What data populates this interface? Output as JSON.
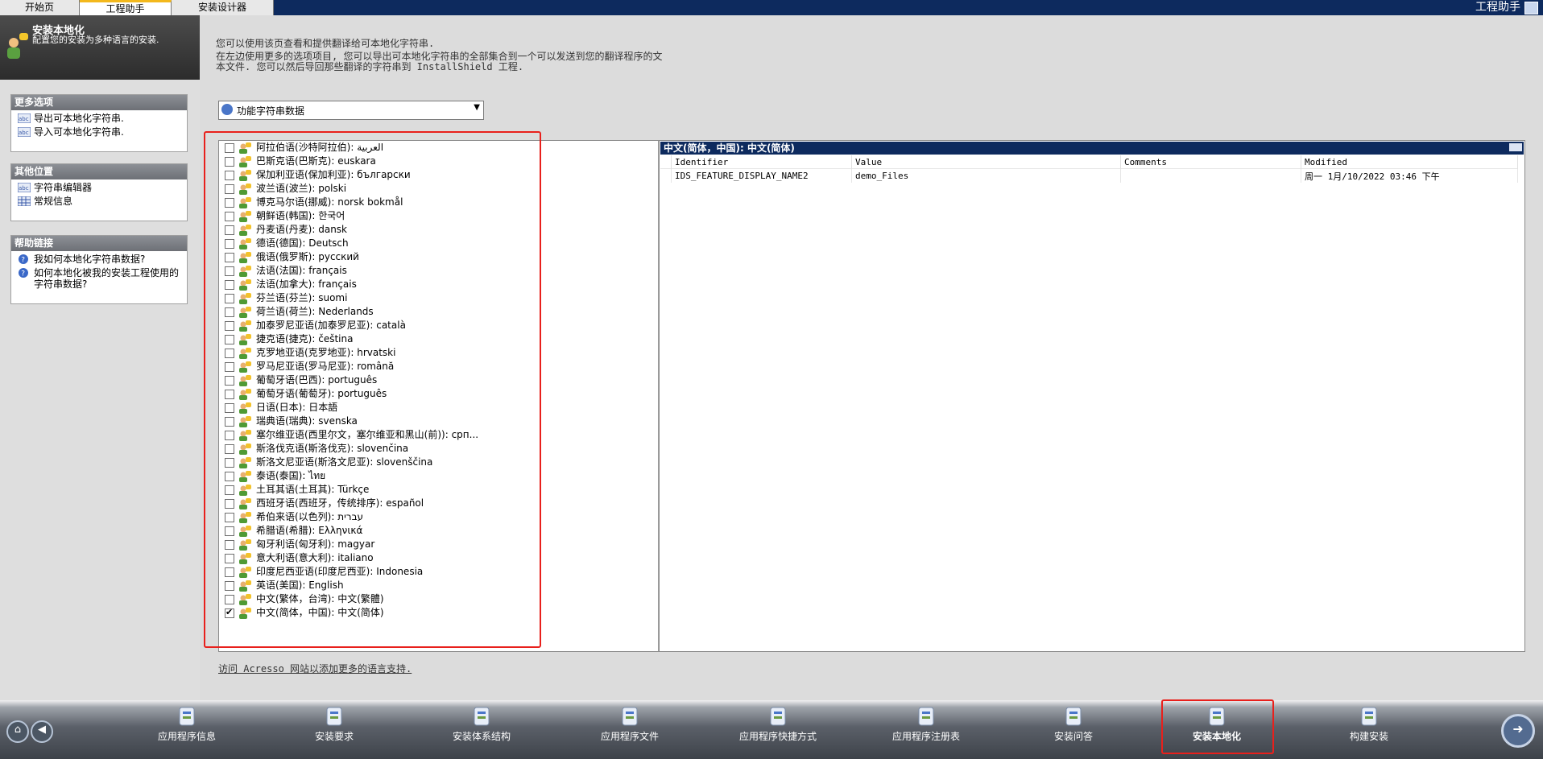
{
  "tabs": [
    "开始页",
    "工程助手",
    "安装设计器"
  ],
  "app_title": "工程助手",
  "header": {
    "title": "安装本地化",
    "subtitle": "配置您的安装为多种语言的安装."
  },
  "sidebar": {
    "more_options": {
      "title": "更多选项",
      "items": [
        "导出可本地化字符串.",
        "导入可本地化字符串."
      ]
    },
    "other_locations": {
      "title": "其他位置",
      "items": [
        "字符串编辑器",
        "常规信息"
      ]
    },
    "help_links": {
      "title": "帮助链接",
      "items": [
        "我如何本地化字符串数据?",
        "如何本地化被我的安装工程使用的字符串数据?"
      ]
    }
  },
  "main": {
    "desc1": "您可以使用该页查看和提供翻译给可本地化字符串.",
    "desc2": "在左边使用更多的选项项目, 您可以导出可本地化字符串的全部集合到一个可以发送到您的翻译程序的文本文件. 您可以然后导回那些翻译的字符串到 InstallShield 工程.",
    "combo_value": "功能字符串数据",
    "link": "访问 Acresso 网站以添加更多的语言支持."
  },
  "languages": [
    {
      "label": "阿拉伯语(沙特阿拉伯): العربية",
      "checked": false
    },
    {
      "label": "巴斯克语(巴斯克): euskara",
      "checked": false
    },
    {
      "label": "保加利亚语(保加利亚): български",
      "checked": false
    },
    {
      "label": "波兰语(波兰): polski",
      "checked": false
    },
    {
      "label": "博克马尔语(挪威): norsk bokmål",
      "checked": false
    },
    {
      "label": "朝鲜语(韩国): 한국어",
      "checked": false
    },
    {
      "label": "丹麦语(丹麦): dansk",
      "checked": false
    },
    {
      "label": "德语(德国): Deutsch",
      "checked": false
    },
    {
      "label": "俄语(俄罗斯): русский",
      "checked": false
    },
    {
      "label": "法语(法国): français",
      "checked": false
    },
    {
      "label": "法语(加拿大): français",
      "checked": false
    },
    {
      "label": "芬兰语(芬兰): suomi",
      "checked": false
    },
    {
      "label": "荷兰语(荷兰): Nederlands",
      "checked": false
    },
    {
      "label": "加泰罗尼亚语(加泰罗尼亚): català",
      "checked": false
    },
    {
      "label": "捷克语(捷克): čeština",
      "checked": false
    },
    {
      "label": "克罗地亚语(克罗地亚): hrvatski",
      "checked": false
    },
    {
      "label": "罗马尼亚语(罗马尼亚): română",
      "checked": false
    },
    {
      "label": "葡萄牙语(巴西): português",
      "checked": false
    },
    {
      "label": "葡萄牙语(葡萄牙): português",
      "checked": false
    },
    {
      "label": "日语(日本): 日本語",
      "checked": false
    },
    {
      "label": "瑞典语(瑞典): svenska",
      "checked": false
    },
    {
      "label": "塞尔维亚语(西里尔文，塞尔维亚和黑山(前)): срп...",
      "checked": false
    },
    {
      "label": "斯洛伐克语(斯洛伐克): slovenčina",
      "checked": false
    },
    {
      "label": "斯洛文尼亚语(斯洛文尼亚): slovenščina",
      "checked": false
    },
    {
      "label": "泰语(泰国): ไทย",
      "checked": false
    },
    {
      "label": "土耳其语(土耳其): Türkçe",
      "checked": false
    },
    {
      "label": "西班牙语(西班牙，传统排序): español",
      "checked": false
    },
    {
      "label": "希伯来语(以色列): עברית",
      "checked": false
    },
    {
      "label": "希腊语(希腊): Ελληνικά",
      "checked": false
    },
    {
      "label": "匈牙利语(匈牙利): magyar",
      "checked": false
    },
    {
      "label": "意大利语(意大利): italiano",
      "checked": false
    },
    {
      "label": "印度尼西亚语(印度尼西亚): Indonesia",
      "checked": false
    },
    {
      "label": "英语(美国): English",
      "checked": false
    },
    {
      "label": "中文(繁体，台湾): 中文(繁體)",
      "checked": false
    },
    {
      "label": "中文(简体，中国): 中文(简体)",
      "checked": true
    }
  ],
  "string_table": {
    "title": "中文(简体，中国): 中文(简体)",
    "columns": [
      "Identifier",
      "Value",
      "Comments",
      "Modified"
    ],
    "rows": [
      [
        "IDS_FEATURE_DISPLAY_NAME2",
        "demo_Files",
        "",
        "周一 1月/10/2022 03:46 下午"
      ]
    ]
  },
  "bottom_nav": [
    {
      "label": "应用程序信息",
      "icon": "app-info-icon",
      "active": false
    },
    {
      "label": "安装要求",
      "icon": "requirements-icon",
      "active": false
    },
    {
      "label": "安装体系结构",
      "icon": "architecture-icon",
      "active": false
    },
    {
      "label": "应用程序文件",
      "icon": "files-icon",
      "active": false
    },
    {
      "label": "应用程序快捷方式",
      "icon": "shortcuts-icon",
      "active": false
    },
    {
      "label": "应用程序注册表",
      "icon": "registry-icon",
      "active": false
    },
    {
      "label": "安装问答",
      "icon": "interview-icon",
      "active": false
    },
    {
      "label": "安装本地化",
      "icon": "localization-icon",
      "active": true
    },
    {
      "label": "构建安装",
      "icon": "build-icon",
      "active": false
    }
  ],
  "colors": {
    "accent_dark": "#0d2a5e",
    "tab_active_bar": "#f3b81c",
    "highlight_red": "#e8201c"
  }
}
